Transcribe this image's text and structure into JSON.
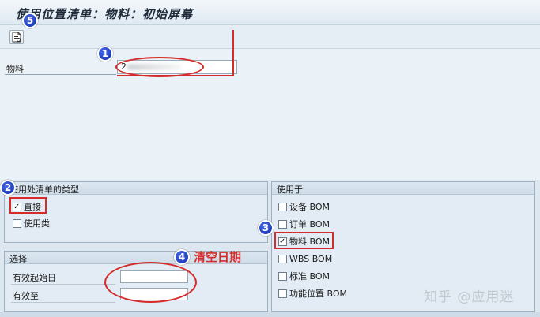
{
  "window": {
    "title": "使用位置清单：物料：初始屏幕"
  },
  "toolbar": {
    "execute_icon": "execute-document-icon"
  },
  "selection": {
    "material_label": "物料",
    "material_value": "2"
  },
  "list_type_group": {
    "title": "使用处清单的类型",
    "options": [
      {
        "label": "直接",
        "checked": true
      },
      {
        "label": "使用类",
        "checked": false
      }
    ]
  },
  "used_in_group": {
    "title": "使用于",
    "options": [
      {
        "label": "设备 BOM",
        "checked": false
      },
      {
        "label": "订单 BOM",
        "checked": false
      },
      {
        "label": "物料 BOM",
        "checked": true
      },
      {
        "label": "WBS BOM",
        "checked": false
      },
      {
        "label": "标准 BOM",
        "checked": false
      },
      {
        "label": "功能位置 BOM",
        "checked": false
      }
    ]
  },
  "selection_group": {
    "title": "选择",
    "valid_from_label": "有效起始日",
    "valid_to_label": "有效至",
    "valid_from_value": "",
    "valid_to_value": ""
  },
  "annotations": {
    "badges": [
      "1",
      "2",
      "3",
      "4",
      "5"
    ],
    "note": "清空日期",
    "color": "#d62b2b",
    "badge_color": "#1a38c0"
  },
  "watermark": "知乎 @应用迷"
}
